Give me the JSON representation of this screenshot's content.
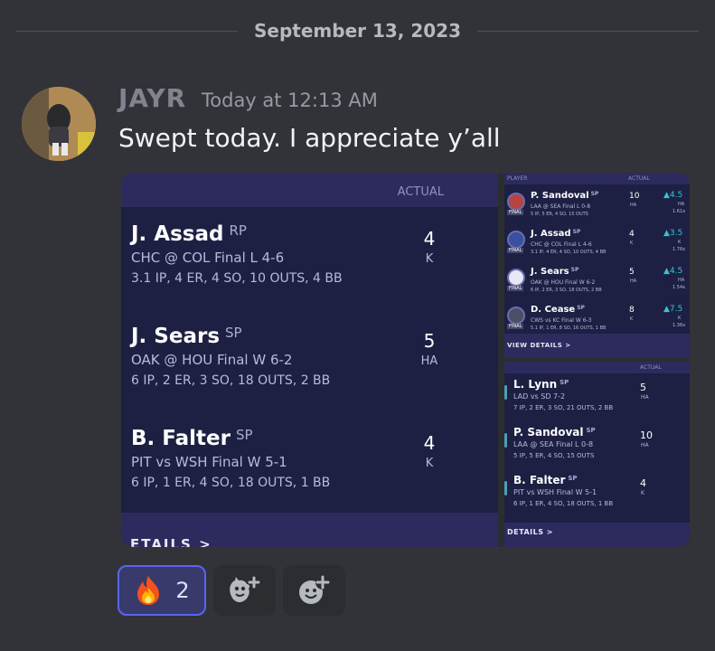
{
  "divider": {
    "date": "September 13, 2023"
  },
  "message": {
    "author": "JAYR",
    "timestamp": "Today at 12:13 AM",
    "text": "Swept today. I appreciate y’all"
  },
  "main_image": {
    "column_header": "ACTUAL",
    "footer_label": "ETAILS >",
    "players": [
      {
        "name": "J. Assad",
        "pos": "RP",
        "game": "CHC @ COL Final L 4-6",
        "stats": "3.1 IP, 4 ER, 4 SO, 10 OUTS, 4 BB",
        "value": "4",
        "unit": "K"
      },
      {
        "name": "J. Sears",
        "pos": "SP",
        "game": "OAK @ HOU Final W 6-2",
        "stats": "6 IP, 2 ER, 3 SO, 18 OUTS, 2 BB",
        "value": "5",
        "unit": "HA"
      },
      {
        "name": "B. Falter",
        "pos": "SP",
        "game": "PIT vs WSH Final W 5-1",
        "stats": "6 IP, 1 ER, 4 SO, 18 OUTS, 1 BB",
        "value": "4",
        "unit": "K"
      }
    ]
  },
  "top_right_image": {
    "header": {
      "player": "PLAYER",
      "actual": "ACTUAL"
    },
    "footer_label": "VIEW DETAILS >",
    "players": [
      {
        "name": "P. Sandoval",
        "pos": "SP",
        "game": "LAA @ SEA Final L 0-8",
        "stats": "5 IP, 5 ER, 4 SO, 15 OUTS",
        "value": "10",
        "unit": "HA",
        "points": "4.5",
        "points_unit": "HA",
        "mult": "1.61x",
        "badge": "FINAL"
      },
      {
        "name": "J. Assad",
        "pos": "SP",
        "game": "CHC @ COL Final L 4-6",
        "stats": "3.1 IP, 4 ER, 4 SO, 10 OUTS, 4 BB",
        "value": "4",
        "unit": "K",
        "points": "3.5",
        "points_unit": "K",
        "mult": "1.76x",
        "badge": "FINAL"
      },
      {
        "name": "J. Sears",
        "pos": "SP",
        "game": "OAK @ HOU Final W 6-2",
        "stats": "6 IP, 2 ER, 3 SO, 18 OUTS, 2 BB",
        "value": "5",
        "unit": "HA",
        "points": "4.5",
        "points_unit": "HA",
        "mult": "1.54x",
        "badge": "FINAL"
      },
      {
        "name": "D. Cease",
        "pos": "SP",
        "game": "CWS vs KC Final W 6-3",
        "stats": "5.1 IP, 1 ER, 8 SO, 16 OUTS, 1 BB",
        "value": "8",
        "unit": "K",
        "points": "7.5",
        "points_unit": "K",
        "mult": "1.36x",
        "badge": "FINAL"
      }
    ]
  },
  "bottom_right_image": {
    "column_header": "ACTUAL",
    "footer_label": "DETAILS >",
    "players": [
      {
        "name": "L. Lynn",
        "pos": "SP",
        "game": "LAD vs SD 7-2",
        "stats": "7 IP, 2 ER, 3 SO, 21 OUTS, 2 BB",
        "value": "5",
        "unit": "HA"
      },
      {
        "name": "P. Sandoval",
        "pos": "SP",
        "game": "LAA @ SEA Final L 0-8",
        "stats": "5 IP, 5 ER, 4 SO, 15 OUTS",
        "value": "10",
        "unit": "HA"
      },
      {
        "name": "B. Falter",
        "pos": "SP",
        "game": "PIT vs WSH Final W 5-1",
        "stats": "6 IP, 1 ER, 4 SO, 18 OUTS, 1 BB",
        "value": "4",
        "unit": "K"
      }
    ]
  },
  "reactions": [
    {
      "emoji": "fire",
      "count": "2"
    }
  ],
  "icons": {
    "add_reaction": "add-reaction-icon",
    "add_super_reaction": "add-super-reaction-icon"
  },
  "colors": {
    "background": "#313338",
    "accent": "#5865f2",
    "card": "#1d2042",
    "band": "#2d2a5e"
  }
}
